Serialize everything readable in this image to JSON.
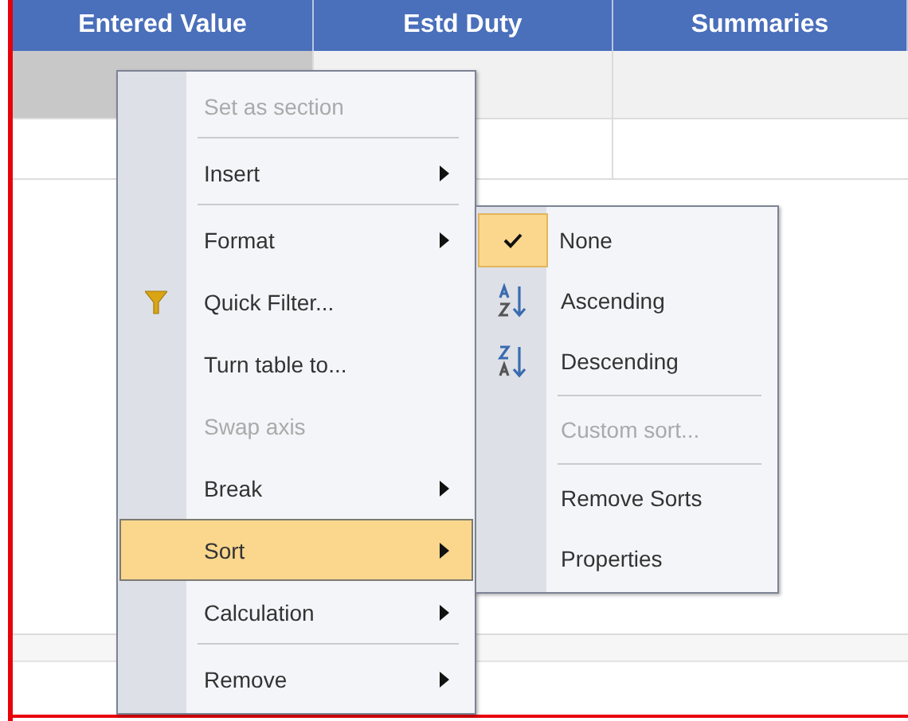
{
  "table": {
    "columns": [
      "Entered Value",
      "Estd Duty",
      "Summaries"
    ],
    "rows": [
      {
        "selected": true
      },
      {
        "selected": false
      }
    ]
  },
  "context_menu": {
    "items": [
      {
        "label": "Set as section",
        "kind": "plain",
        "disabled": true,
        "selected": false,
        "submenu": false,
        "separator_after": true
      },
      {
        "label": "Insert",
        "kind": "plain",
        "disabled": false,
        "selected": false,
        "submenu": true,
        "separator_after": true
      },
      {
        "label": "Format",
        "kind": "plain",
        "disabled": false,
        "selected": false,
        "submenu": true,
        "separator_after": false
      },
      {
        "label": "Quick Filter...",
        "kind": "filter",
        "disabled": false,
        "selected": false,
        "submenu": false,
        "separator_after": false
      },
      {
        "label": "Turn table to...",
        "kind": "plain",
        "disabled": false,
        "selected": false,
        "submenu": false,
        "separator_after": false
      },
      {
        "label": "Swap axis",
        "kind": "plain",
        "disabled": true,
        "selected": false,
        "submenu": false,
        "separator_after": false
      },
      {
        "label": "Break",
        "kind": "plain",
        "disabled": false,
        "selected": false,
        "submenu": true,
        "separator_after": false
      },
      {
        "label": "Sort",
        "kind": "plain",
        "disabled": false,
        "selected": true,
        "submenu": true,
        "separator_after": false
      },
      {
        "label": "Calculation",
        "kind": "plain",
        "disabled": false,
        "selected": false,
        "submenu": true,
        "separator_after": true
      },
      {
        "label": "Remove",
        "kind": "plain",
        "disabled": false,
        "selected": false,
        "submenu": true,
        "separator_after": false
      }
    ]
  },
  "sort_submenu": {
    "items": [
      {
        "label": "None",
        "kind": "check",
        "checked": true,
        "disabled": false,
        "separator_after": false
      },
      {
        "label": "Ascending",
        "kind": "ascending",
        "checked": false,
        "disabled": false,
        "separator_after": false
      },
      {
        "label": "Descending",
        "kind": "descending",
        "checked": false,
        "disabled": false,
        "separator_after": true
      },
      {
        "label": "Custom sort...",
        "kind": "plain",
        "checked": false,
        "disabled": true,
        "separator_after": true
      },
      {
        "label": "Remove Sorts",
        "kind": "plain",
        "checked": false,
        "disabled": false,
        "separator_after": false
      },
      {
        "label": "Properties",
        "kind": "plain",
        "checked": false,
        "disabled": false,
        "separator_after": false
      }
    ]
  }
}
